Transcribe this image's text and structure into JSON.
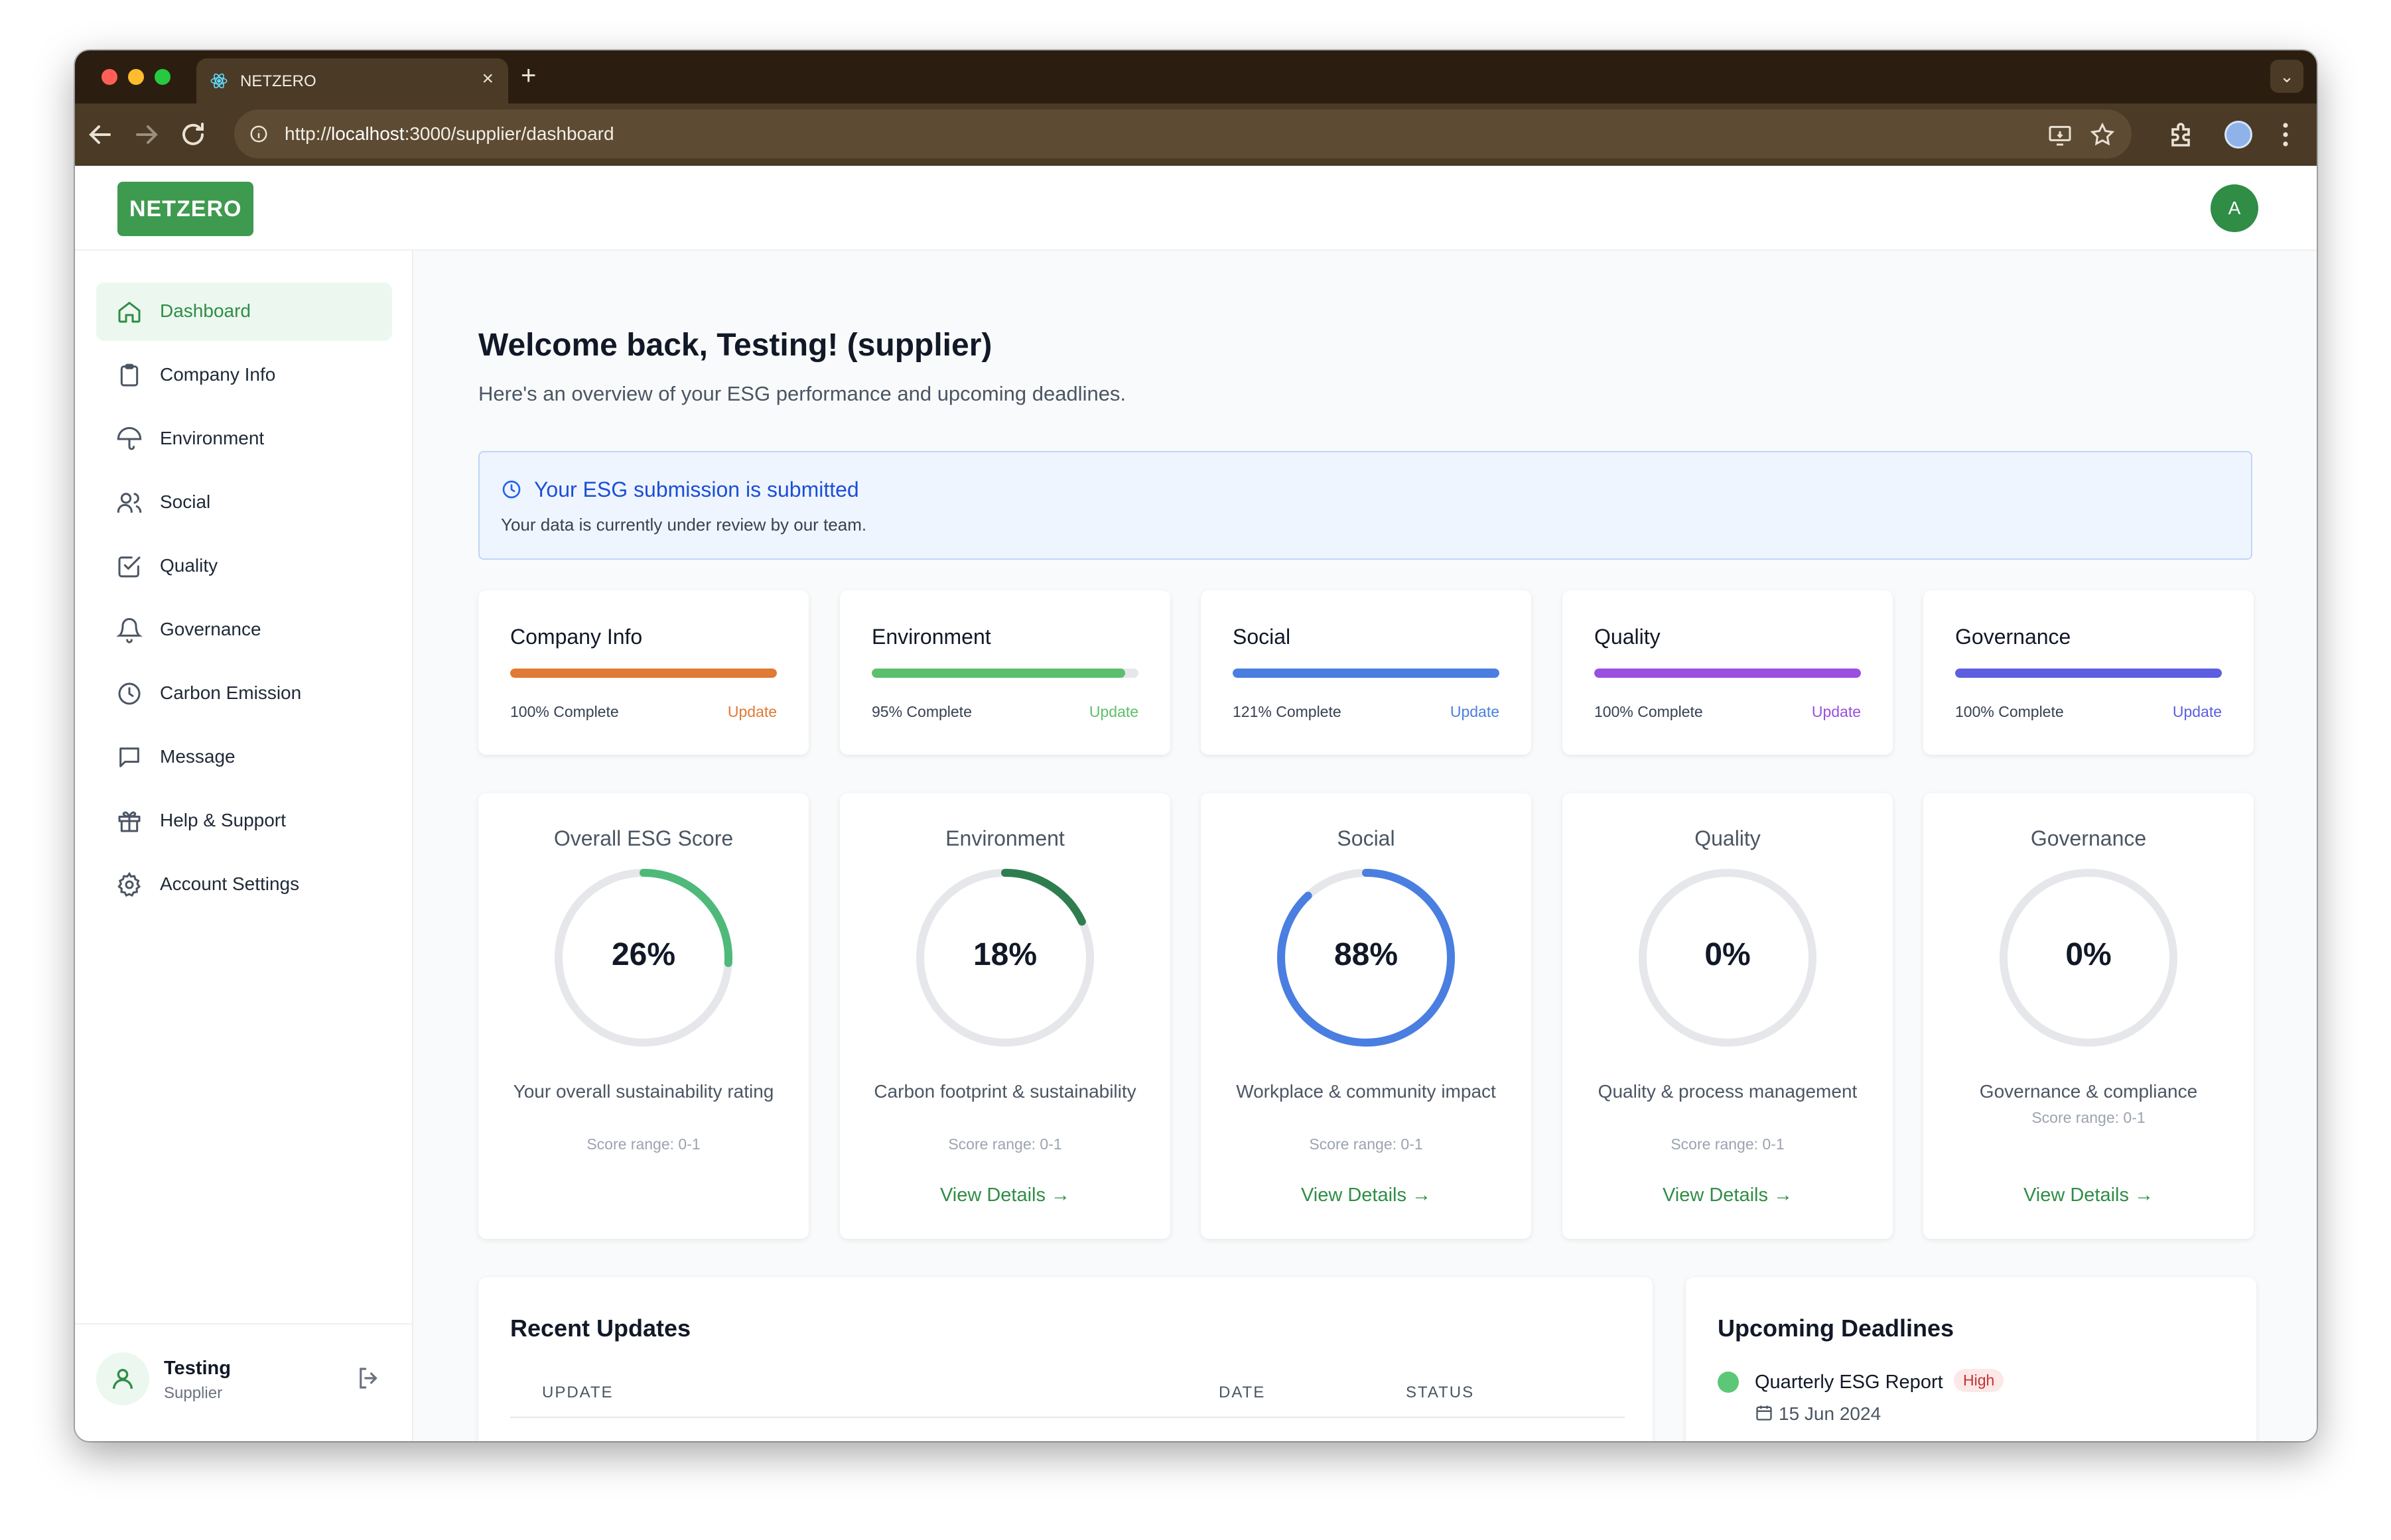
{
  "browser": {
    "tab_title": "NETZERO",
    "url_scheme": "http://",
    "url_host": "localhost",
    "url_path": ":3000/supplier/dashboard"
  },
  "header": {
    "logo": "NETZERO",
    "avatar_initial": "A"
  },
  "sidebar": {
    "items": [
      {
        "label": "Dashboard",
        "icon": "home-icon"
      },
      {
        "label": "Company Info",
        "icon": "clipboard-icon"
      },
      {
        "label": "Environment",
        "icon": "umbrella-icon"
      },
      {
        "label": "Social",
        "icon": "users-icon"
      },
      {
        "label": "Quality",
        "icon": "check-square-icon"
      },
      {
        "label": "Governance",
        "icon": "bell-icon"
      },
      {
        "label": "Carbon Emission",
        "icon": "clock-icon"
      },
      {
        "label": "Message",
        "icon": "message-icon"
      },
      {
        "label": "Help & Support",
        "icon": "gift-icon"
      },
      {
        "label": "Account Settings",
        "icon": "gear-icon"
      }
    ],
    "active_index": 0,
    "user": {
      "name": "Testing",
      "role": "Supplier"
    }
  },
  "main": {
    "welcome": "Welcome back, Testing! (supplier)",
    "subtitle": "Here's an overview of your ESG performance and upcoming deadlines.",
    "alert": {
      "title": "Your ESG submission is submitted",
      "text": "Your data is currently under review by our team."
    },
    "progress_cards": [
      {
        "title": "Company Info",
        "status": "100% Complete",
        "fill": 1.0,
        "update": "Update",
        "color": "#e07a34"
      },
      {
        "title": "Environment",
        "status": "95% Complete",
        "fill": 0.95,
        "update": "Update",
        "color": "#5cbf6c"
      },
      {
        "title": "Social",
        "status": "121% Complete",
        "fill": 1.0,
        "update": "Update",
        "color": "#4a7ee0"
      },
      {
        "title": "Quality",
        "status": "100% Complete",
        "fill": 1.0,
        "update": "Update",
        "color": "#9b4fe0"
      },
      {
        "title": "Governance",
        "status": "100% Complete",
        "fill": 1.0,
        "update": "Update",
        "color": "#5b5fe0"
      }
    ],
    "score_cards": [
      {
        "title": "Overall ESG Score",
        "percent": "26%",
        "fraction": 0.26,
        "desc": "Your overall sustainability rating",
        "range": "Score range: 0-1",
        "link": "",
        "color": "#4fb97a"
      },
      {
        "title": "Environment",
        "percent": "18%",
        "fraction": 0.18,
        "desc": "Carbon footprint & sustainability",
        "range": "Score range: 0-1",
        "link": "View Details →",
        "color": "#2e7d4f"
      },
      {
        "title": "Social",
        "percent": "88%",
        "fraction": 0.88,
        "desc": "Workplace & community impact",
        "range": "Score range: 0-1",
        "link": "View Details →",
        "color": "#4a7ee0"
      },
      {
        "title": "Quality",
        "percent": "0%",
        "fraction": 0.0,
        "desc": "Quality & process management",
        "range": "Score range: 0-1",
        "link": "View Details →",
        "color": "#9b4fe0"
      },
      {
        "title": "Governance",
        "percent": "0%",
        "fraction": 0.0,
        "desc": "Governance & compliance",
        "range": "Score range: 0-1",
        "link": "View Details →",
        "color": "#5b5fe0"
      }
    ],
    "recent_updates": {
      "title": "Recent Updates",
      "columns": [
        "UPDATE",
        "DATE",
        "STATUS"
      ]
    },
    "deadlines": {
      "title": "Upcoming Deadlines",
      "items": [
        {
          "title": "Quarterly ESG Report",
          "priority": "High",
          "date": "15 Jun 2024"
        }
      ]
    }
  }
}
